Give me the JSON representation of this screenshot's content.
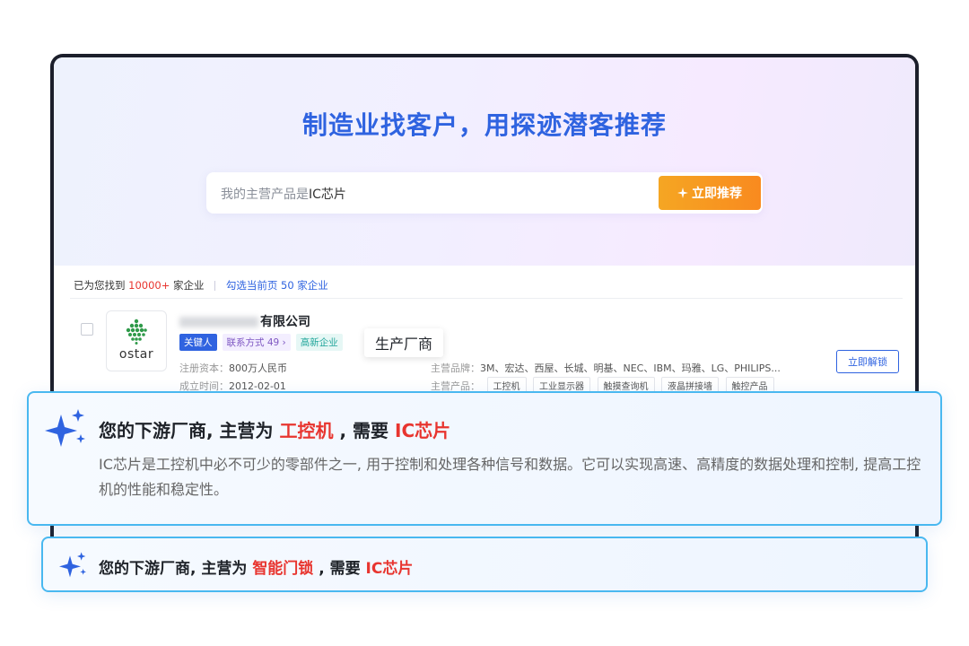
{
  "hero": {
    "title": "制造业找客户，用探迹潜客推荐",
    "search_prefix": "我的主营产品是",
    "search_value": "IC芯片",
    "recommend_button": "立即推荐"
  },
  "summary": {
    "found_prefix": "已为您找到",
    "found_count": "10000+",
    "found_suffix": "家企业",
    "select_text": "勾选当前页 50 家企业"
  },
  "company": {
    "logo_text": "ostar",
    "name_suffix": "有限公司",
    "tags": {
      "key_person": "关键人",
      "contact": "联系方式 49 ›",
      "tech": "高新企业"
    },
    "tooltip": "生产厂商",
    "capital_label": "注册资本：",
    "capital_value": "800万人民币",
    "founded_label": "成立时间：",
    "founded_value": "2012-02-01",
    "brands_label": "主营品牌：",
    "brands_value": "3M、宏达、西屋、长城、明基、NEC、IBM、玛雅、LG、PHILIPS...",
    "products_label": "主营产品：",
    "products": [
      "工控机",
      "工业显示器",
      "触摸查询机",
      "液晶拼接墙",
      "触控产品"
    ],
    "unlock_button": "立即解锁"
  },
  "card1": {
    "prefix": "您的下游厂商, 主营为",
    "product": "工控机",
    "middle": ", 需要",
    "need": "IC芯片",
    "description": "IC芯片是工控机中必不可少的零部件之一, 用于控制和处理各种信号和数据。它可以实现高速、高精度的数据处理和控制, 提高工控机的性能和稳定性。"
  },
  "card2": {
    "prefix": "您的下游厂商, 主营为",
    "product": "智能门锁",
    "middle": ", 需要",
    "need": "IC芯片"
  },
  "colors": {
    "accent": "#2f63e0",
    "highlight": "#e8352f",
    "button": "#f5a623",
    "card_border": "#49b8f0"
  },
  "icons": [
    "sparkle-icon",
    "checkbox-icon"
  ]
}
